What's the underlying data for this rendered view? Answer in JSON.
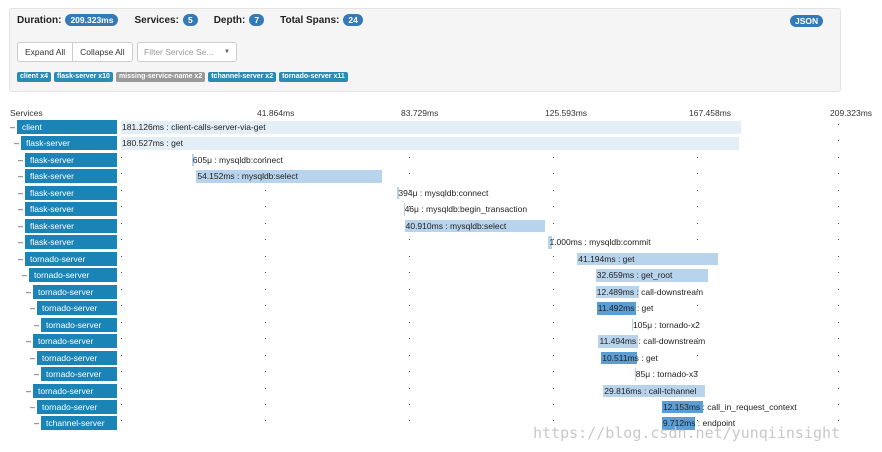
{
  "summary": {
    "duration_label": "Duration:",
    "duration": "209.323ms",
    "services_label": "Services:",
    "services": "5",
    "depth_label": "Depth:",
    "depth": "7",
    "spans_label": "Total Spans:",
    "spans": "24",
    "json_button": "JSON"
  },
  "controls": {
    "expand_all": "Expand All",
    "collapse_all": "Collapse All",
    "filter_placeholder": "Filter Service Se...",
    "filter_caret": "▼"
  },
  "service_tags": [
    {
      "label": "client x4",
      "color": "#2a8cb5"
    },
    {
      "label": "flask-server x10",
      "color": "#2a8cb5"
    },
    {
      "label": "missing-service-name x2",
      "color": "#999999"
    },
    {
      "label": "tchannel-server x2",
      "color": "#2a8cb5"
    },
    {
      "label": "tornado-server x11",
      "color": "#2a8cb5"
    }
  ],
  "timeline": {
    "services_header": "Services",
    "ticks": [
      "41.864ms",
      "83.729ms",
      "125.593ms",
      "167.458ms",
      "209.323ms"
    ],
    "total_ms": 209.323
  },
  "spans": [
    {
      "service": "client",
      "depth": 0,
      "start_ms": 0.0,
      "duration_ms": 181.126,
      "label": "181.126ms : client-calls-server-via-get"
    },
    {
      "service": "flask-server",
      "depth": 1,
      "start_ms": 0.0,
      "duration_ms": 180.527,
      "label": "180.527ms : get"
    },
    {
      "service": "flask-server",
      "depth": 2,
      "start_ms": 20.7,
      "duration_ms": 0.605,
      "label": "605μ : mysqldb:connect"
    },
    {
      "service": "flask-server",
      "depth": 2,
      "start_ms": 22.0,
      "duration_ms": 54.152,
      "label": "54.152ms : mysqldb:select"
    },
    {
      "service": "flask-server",
      "depth": 2,
      "start_ms": 80.7,
      "duration_ms": 0.394,
      "label": "394μ : mysqldb:connect"
    },
    {
      "service": "flask-server",
      "depth": 2,
      "start_ms": 82.5,
      "duration_ms": 0.046,
      "label": "46μ : mysqldb:begin_transaction"
    },
    {
      "service": "flask-server",
      "depth": 2,
      "start_ms": 82.8,
      "duration_ms": 40.91,
      "label": "40.910ms : mysqldb:select"
    },
    {
      "service": "flask-server",
      "depth": 2,
      "start_ms": 124.8,
      "duration_ms": 1.0,
      "label": "1.000ms : mysqldb:commit"
    },
    {
      "service": "tornado-server",
      "depth": 2,
      "start_ms": 133.2,
      "duration_ms": 41.194,
      "label": "41.194ms : get"
    },
    {
      "service": "tornado-server",
      "depth": 3,
      "start_ms": 138.6,
      "duration_ms": 32.659,
      "label": "32.659ms : get_root"
    },
    {
      "service": "tornado-server",
      "depth": 4,
      "start_ms": 138.6,
      "duration_ms": 12.489,
      "label": "12.489ms : call-downstream"
    },
    {
      "service": "tornado-server",
      "depth": 5,
      "start_ms": 138.9,
      "duration_ms": 11.492,
      "label": "11.492ms : get"
    },
    {
      "service": "tornado-server",
      "depth": 6,
      "start_ms": 149.2,
      "duration_ms": 0.105,
      "label": "105μ : tornado-x2"
    },
    {
      "service": "tornado-server",
      "depth": 4,
      "start_ms": 139.4,
      "duration_ms": 11.494,
      "label": "11.494ms : call-downstream"
    },
    {
      "service": "tornado-server",
      "depth": 5,
      "start_ms": 140.2,
      "duration_ms": 10.511,
      "label": "10.511ms : get"
    },
    {
      "service": "tornado-server",
      "depth": 6,
      "start_ms": 150.0,
      "duration_ms": 0.085,
      "label": "85μ : tornado-x3"
    },
    {
      "service": "tornado-server",
      "depth": 4,
      "start_ms": 140.8,
      "duration_ms": 29.816,
      "label": "29.816ms : call-tchannel"
    },
    {
      "service": "tornado-server",
      "depth": 5,
      "start_ms": 157.9,
      "duration_ms": 12.153,
      "label": "12.153ms : call_in_request_context"
    },
    {
      "service": "tchannel-server",
      "depth": 6,
      "start_ms": 157.9,
      "duration_ms": 9.712,
      "label": "9.712ms : endpoint"
    }
  ],
  "watermark": "https://blog.csdn.net/yunqiinsight",
  "colors": {
    "service_label": "#1b84b6",
    "bar_outer": "#e4eef6",
    "bar_light": "#b7d4ec",
    "bar_mid": "#9bc3e2",
    "bar_dark": "#5b9ed4",
    "badge": "#337ab7"
  }
}
